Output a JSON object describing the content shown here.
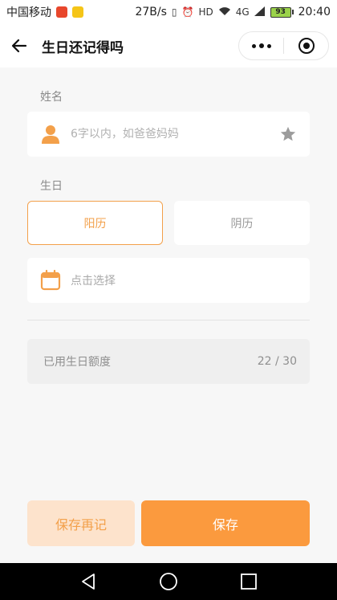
{
  "status_bar": {
    "carrier": "中国移动",
    "speed": "27B/s",
    "network": "4G",
    "battery": "93",
    "time": "20:40"
  },
  "header": {
    "title": "生日还记得吗"
  },
  "name_section": {
    "label": "姓名",
    "placeholder": "6字以内，如爸爸妈妈"
  },
  "birthday_section": {
    "label": "生日",
    "tabs": [
      {
        "label": "阳历",
        "selected": true
      },
      {
        "label": "阴历",
        "selected": false
      }
    ],
    "date_placeholder": "点击选择"
  },
  "quota": {
    "label": "已用生日额度",
    "count": "22 / 30"
  },
  "buttons": {
    "save_again": "保存再记",
    "save": "保存"
  },
  "colors": {
    "accent": "#f3a04a",
    "accent_strong": "#fb9a3e",
    "accent_soft": "#fde3cc",
    "background": "#f7f7f7"
  }
}
